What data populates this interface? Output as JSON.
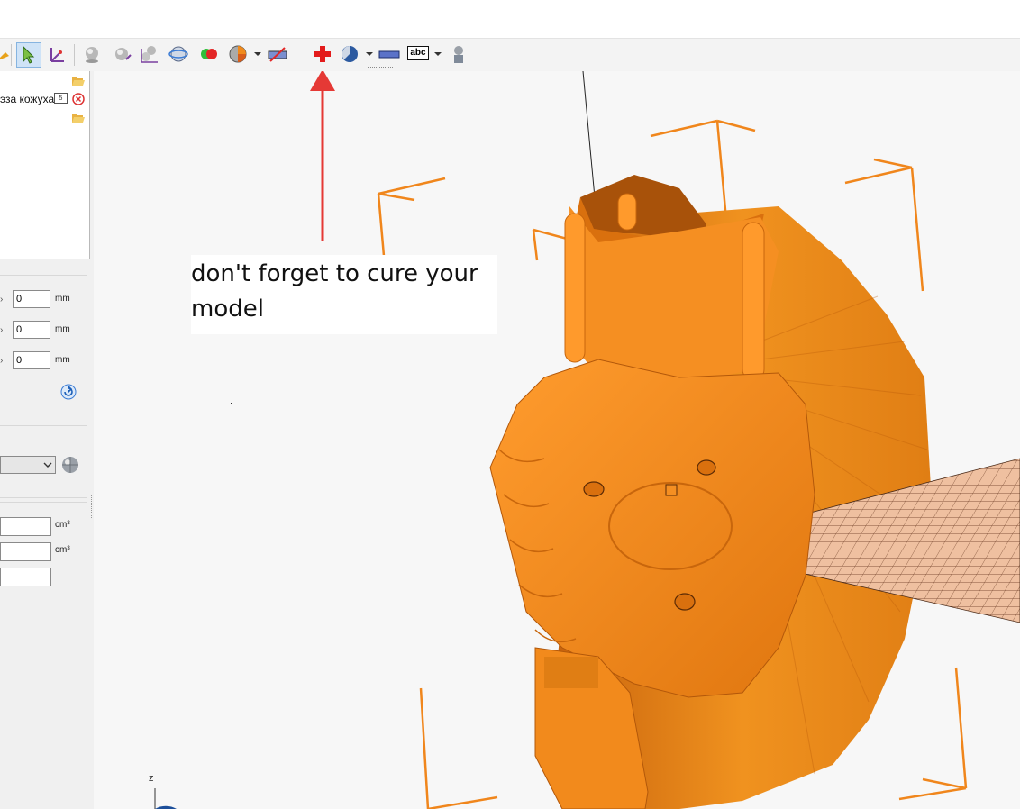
{
  "tree": {
    "item_label": "эза кожуха",
    "item_badge": "5"
  },
  "position": {
    "x": {
      "value": "0",
      "unit": "mm"
    },
    "y": {
      "value": "0",
      "unit": "mm"
    },
    "z": {
      "value": "0",
      "unit": "mm"
    }
  },
  "volume": {
    "row1_unit": "cm³",
    "row2_unit": "cm³"
  },
  "annotation": {
    "line1": "don't forget to cure your",
    "line2": "model"
  },
  "axis": {
    "z_label": "z"
  },
  "toolbar": {
    "icons": [
      "move-icon",
      "select-arrow-icon",
      "axis-icon",
      "sphere-icon",
      "sphere-rotate-icon",
      "spheres-icon",
      "globe-icon",
      "color-spheres-icon",
      "pie-icon",
      "measure-icon",
      "add-support-icon",
      "view-icon",
      "ruler-icon",
      "text-abc-icon",
      "person-icon"
    ],
    "text_button": "abc"
  },
  "colors": {
    "model": "#f08a1c",
    "arrow": "#e53935",
    "panel": "#f0f0f0"
  }
}
